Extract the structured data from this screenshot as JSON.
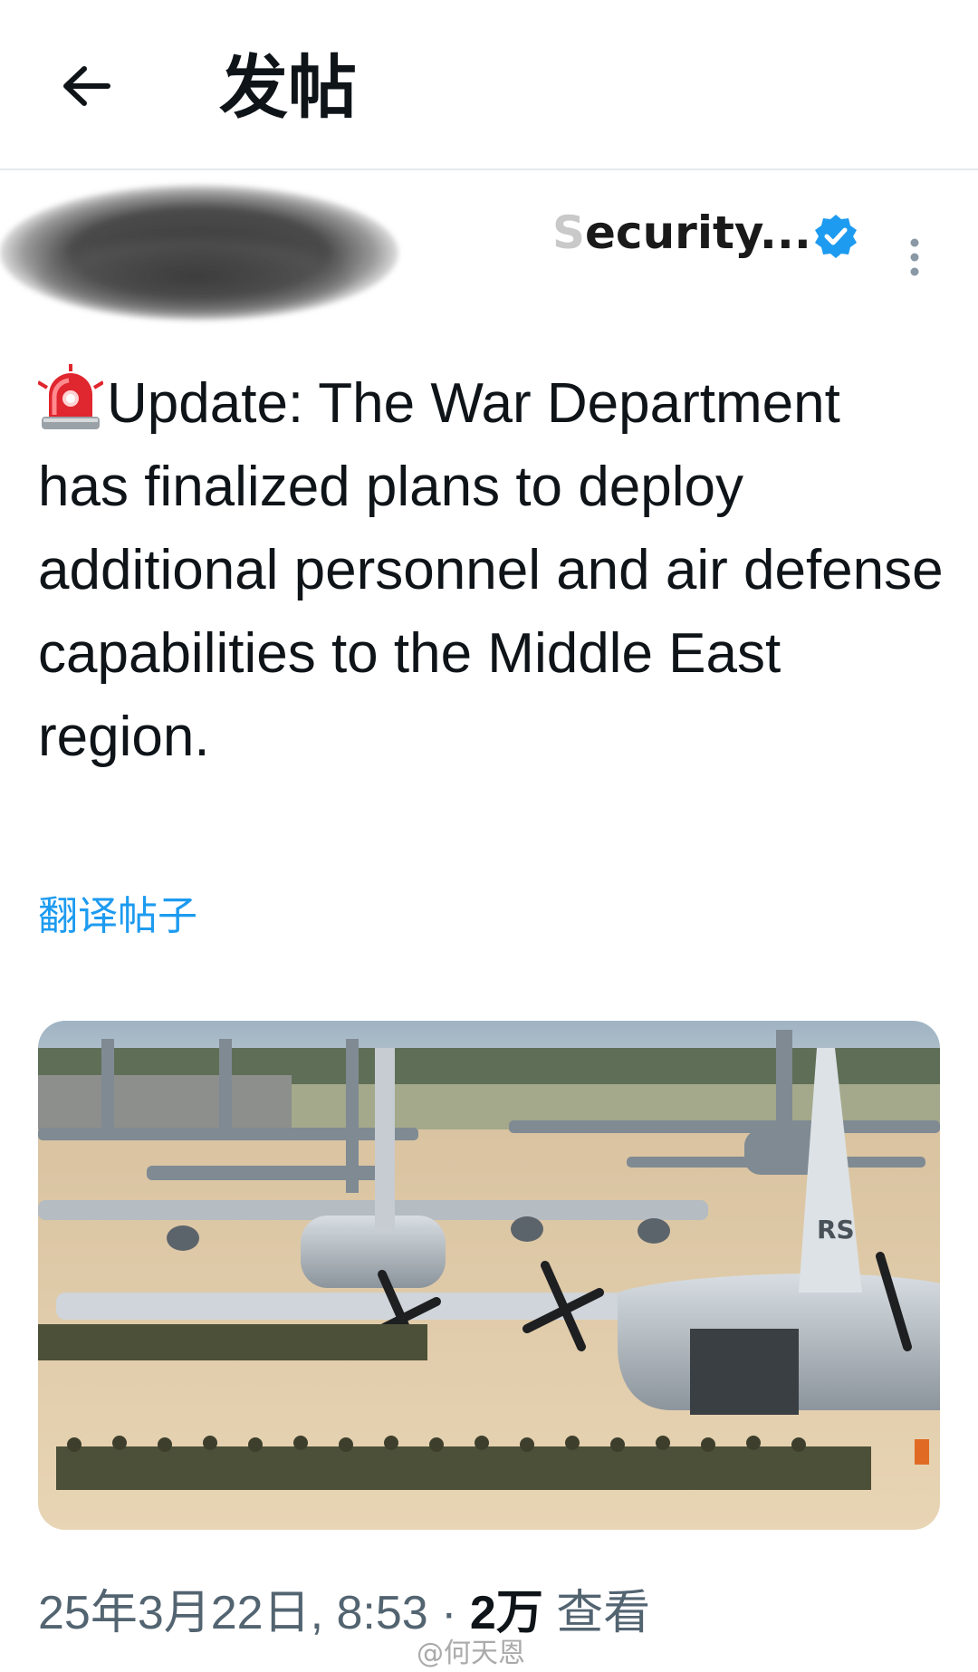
{
  "header": {
    "title": "发帖",
    "back_icon": "arrow-left-icon"
  },
  "author": {
    "name_visible": "ecurity...",
    "name_faded_prefix": "S",
    "verified_icon": "verified-badge-icon",
    "verified_color": "#1d9bf0",
    "more_icon": "more-vertical-icon"
  },
  "post": {
    "emoji_icon": "rotating-light-icon",
    "text": "Update: The War Department has finalized plans to deploy additional personnel and air defense capabilities to the Middle East region.",
    "translate_label": "翻译帖子",
    "image_alt": "Soldiers boarding military cargo aircraft on an airfield"
  },
  "meta": {
    "timestamp": "25年3月22日, 8:53",
    "separator": " · ",
    "views_count": "2万",
    "views_label": " 查看"
  },
  "watermark": {
    "text": "@何天恩"
  },
  "colors": {
    "accent": "#1d9bf0",
    "secondary_text": "#536471",
    "primary_text": "#0f1419"
  }
}
